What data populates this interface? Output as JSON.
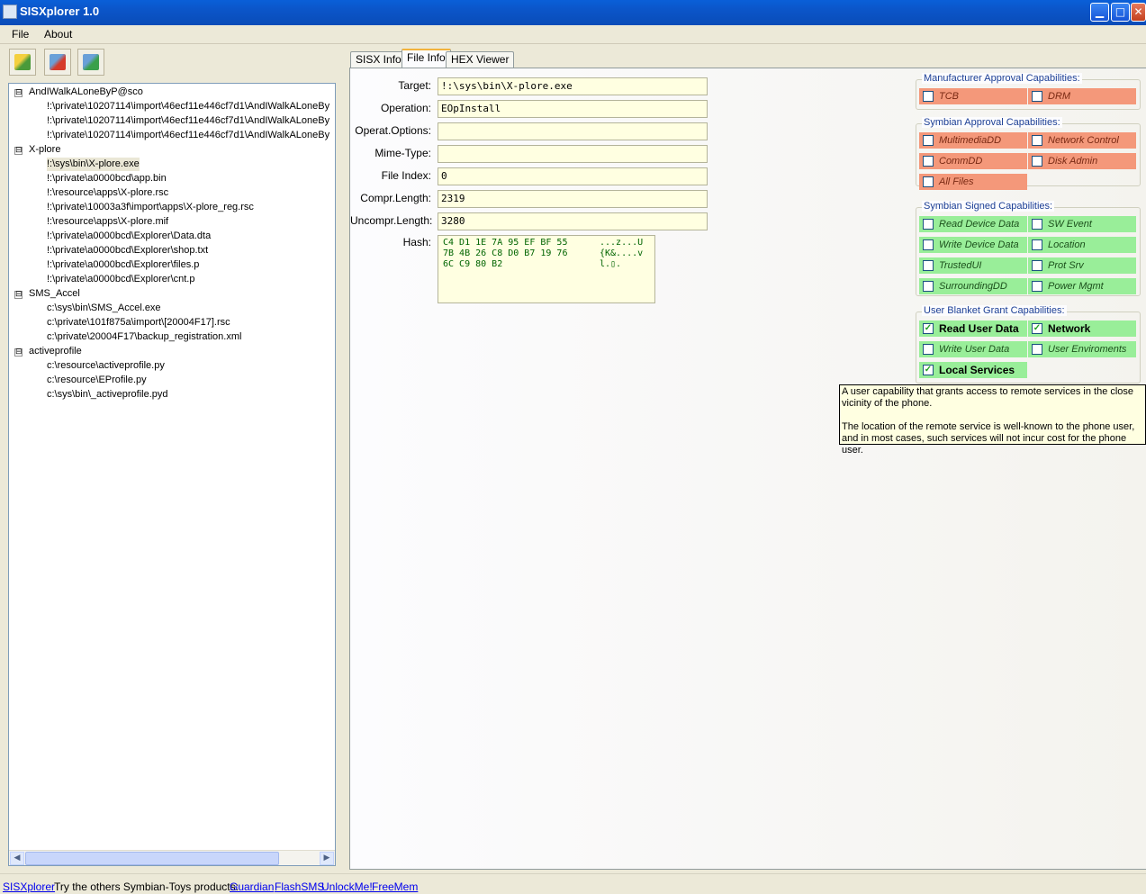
{
  "window": {
    "title": "SISXplorer 1.0",
    "icons": {
      "app": "sisx-app-icon",
      "min": "minimize-icon",
      "max": "maximize-icon",
      "close": "close-icon"
    },
    "min_glyph": "▁",
    "max_glyph": "□",
    "close_glyph": "✕"
  },
  "menu": {
    "file": "File",
    "about": "About"
  },
  "toolbar": {
    "buttons": [
      "open-package-icon",
      "remove-package-icon",
      "refresh-package-icon"
    ]
  },
  "tree": {
    "groups": [
      {
        "label": "AndIWalkALoneByP@sco",
        "expander": "⊟",
        "items": [
          "!:\\private\\10207114\\import\\46ecf11e446cf7d1\\AndIWalkALoneBy",
          "!:\\private\\10207114\\import\\46ecf11e446cf7d1\\AndIWalkALoneBy",
          "!:\\private\\10207114\\import\\46ecf11e446cf7d1\\AndIWalkALoneBy"
        ]
      },
      {
        "label": "X-plore",
        "expander": "⊟",
        "items": [
          "!:\\sys\\bin\\X-plore.exe",
          "!:\\private\\a0000bcd\\app.bin",
          "!:\\resource\\apps\\X-plore.rsc",
          "!:\\private\\10003a3f\\import\\apps\\X-plore_reg.rsc",
          "!:\\resource\\apps\\X-plore.mif",
          "!:\\private\\a0000bcd\\Explorer\\Data.dta",
          "!:\\private\\a0000bcd\\Explorer\\shop.txt",
          "!:\\private\\a0000bcd\\Explorer\\files.p",
          "!:\\private\\a0000bcd\\Explorer\\cnt.p"
        ]
      },
      {
        "label": "SMS_Accel",
        "expander": "⊟",
        "items": [
          "c:\\sys\\bin\\SMS_Accel.exe",
          "c:\\private\\101f875a\\import\\[20004F17].rsc",
          "c:\\private\\20004F17\\backup_registration.xml"
        ]
      },
      {
        "label": "activeprofile",
        "expander": "⊟",
        "items": [
          "c:\\resource\\activeprofile.py",
          "c:\\resource\\EProfile.py",
          "c:\\sys\\bin\\_activeprofile.pyd"
        ]
      }
    ],
    "selected": "!:\\sys\\bin\\X-plore.exe",
    "scroll_left": "◀",
    "scroll_right": "▶"
  },
  "tabs": [
    "SISX Info",
    "File Info",
    "HEX Viewer"
  ],
  "active_tab": "File Info",
  "file_info": {
    "target_label": "Target:",
    "target": "!:\\sys\\bin\\X-plore.exe",
    "operation_label": "Operation:",
    "operation": "EOpInstall",
    "options_label": "Operat.Options:",
    "options": "",
    "mime_label": "Mime-Type:",
    "mime": "",
    "index_label": "File Index:",
    "index": "0",
    "compr_label": "Compr.Length:",
    "compr": "2319",
    "uncompr_label": "Uncompr.Length:",
    "uncompr": "3280",
    "hash_label": "Hash:",
    "hash_hex": [
      "C4 D1 1E 7A 95 EF BF 55",
      "7B 4B 26 C8 D0 B7 19 76",
      "6C C9 80 B2"
    ],
    "hash_ascii": [
      "...z...U",
      "{K&....v",
      "l.▯."
    ]
  },
  "capabilities": {
    "check_glyph": "✓",
    "manufacturer": {
      "title": "Manufacturer Approval Capabilities:",
      "items": [
        {
          "label": "TCB",
          "checked": false
        },
        {
          "label": "DRM",
          "checked": false
        }
      ]
    },
    "symbian_approval": {
      "title": "Symbian Approval Capabilities:",
      "items": [
        {
          "label": "MultimediaDD",
          "checked": false
        },
        {
          "label": "Network Control",
          "checked": false
        },
        {
          "label": "CommDD",
          "checked": false
        },
        {
          "label": "Disk Admin",
          "checked": false
        },
        {
          "label": "All Files",
          "checked": false
        }
      ]
    },
    "symbian_signed": {
      "title": "Symbian Signed Capabilities:",
      "items": [
        {
          "label": "Read Device Data",
          "checked": false
        },
        {
          "label": "SW Event",
          "checked": false
        },
        {
          "label": "Write Device Data",
          "checked": false
        },
        {
          "label": "Location",
          "checked": false
        },
        {
          "label": "TrustedUI",
          "checked": false
        },
        {
          "label": "Prot Srv",
          "checked": false
        },
        {
          "label": "SurroundingDD",
          "checked": false
        },
        {
          "label": "Power Mgmt",
          "checked": false
        }
      ]
    },
    "user_grant": {
      "title": "User Blanket Grant Capabilities:",
      "items": [
        {
          "label": "Read User Data",
          "checked": true
        },
        {
          "label": "Network",
          "checked": true
        },
        {
          "label": "Write User Data",
          "checked": false
        },
        {
          "label": "User Enviroments",
          "checked": false
        },
        {
          "label": "Local Services",
          "checked": true
        }
      ]
    }
  },
  "tooltip": {
    "line1": "A user capability that grants access to remote services in the close",
    "line2": "vicinity of the phone.",
    "line3": "The location of the remote service is well-known to the phone user,",
    "line4": "and in most cases, such services will not incur cost for the phone user."
  },
  "status": {
    "app_link": "SISXplorer",
    "text": "Try the others Symbian-Toys products:",
    "links": [
      "Guardian",
      "FlashSMS",
      "UnlockMe!",
      "FreeMem"
    ]
  },
  "colors": {
    "red_cap": "#f4987a",
    "green_cap": "#99ee99",
    "titlebar": "#0a5fd8"
  }
}
